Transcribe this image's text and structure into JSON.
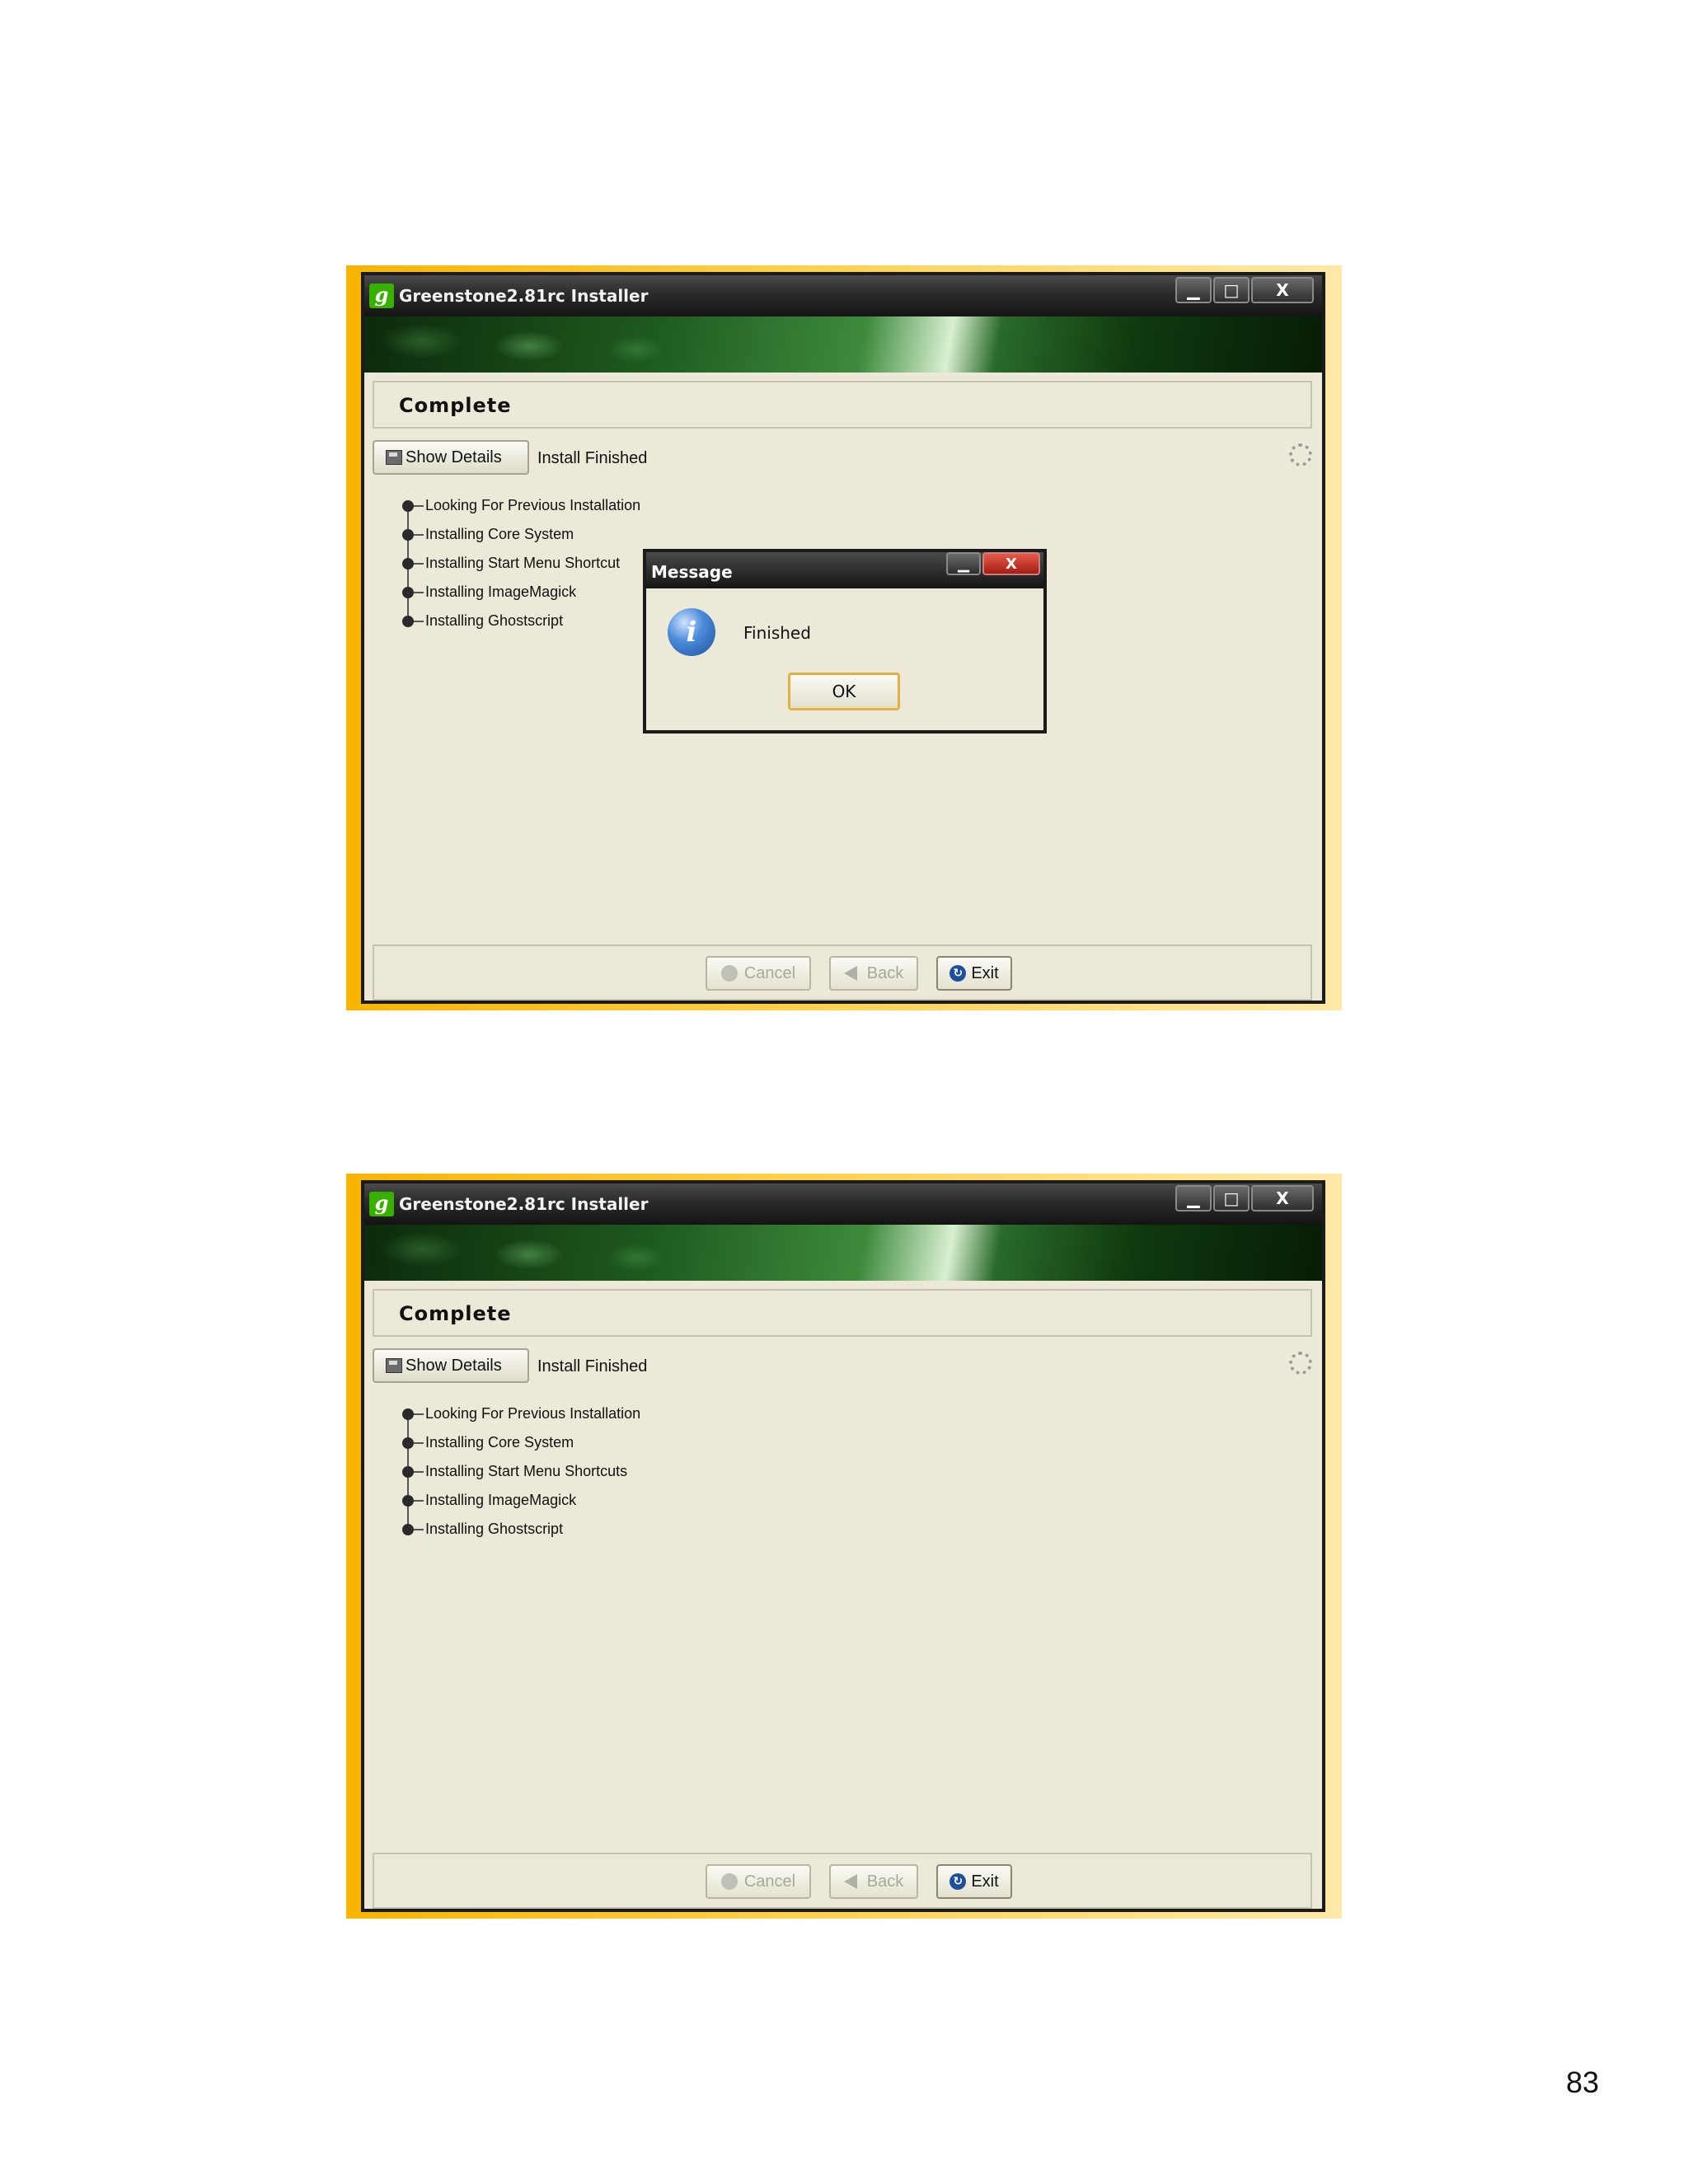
{
  "screenshots": [
    {
      "window_title": "Greenstone2.81rc Installer",
      "window_buttons": {
        "minimize": "▁",
        "maximize": "□",
        "close": "X"
      },
      "step_title": "Complete",
      "show_details_label": "Show Details",
      "status": "Install Finished",
      "steps": [
        "Looking For Previous Installation",
        "Installing Core System",
        "Installing Start Menu Shortcut",
        "Installing ImageMagick",
        "Installing Ghostscript"
      ],
      "buttons": {
        "cancel": "Cancel",
        "back": "Back",
        "exit": "Exit"
      },
      "dialog": {
        "title": "Message",
        "message": "Finished",
        "ok": "OK",
        "min": "▁",
        "close": "X"
      }
    },
    {
      "window_title": "Greenstone2.81rc Installer",
      "window_buttons": {
        "minimize": "▁",
        "maximize": "□",
        "close": "X"
      },
      "step_title": "Complete",
      "show_details_label": "Show Details",
      "status": "Install Finished",
      "steps": [
        "Looking For Previous Installation",
        "Installing Core System",
        "Installing Start Menu Shortcuts",
        "Installing ImageMagick",
        "Installing Ghostscript"
      ],
      "buttons": {
        "cancel": "Cancel",
        "back": "Back",
        "exit": "Exit"
      }
    }
  ],
  "app_icon_letter": "g",
  "page_number": "83",
  "colors": {
    "highlight_frame": "#f8b400",
    "window_bg": "#ece9d8",
    "titlebar": "#141414"
  }
}
